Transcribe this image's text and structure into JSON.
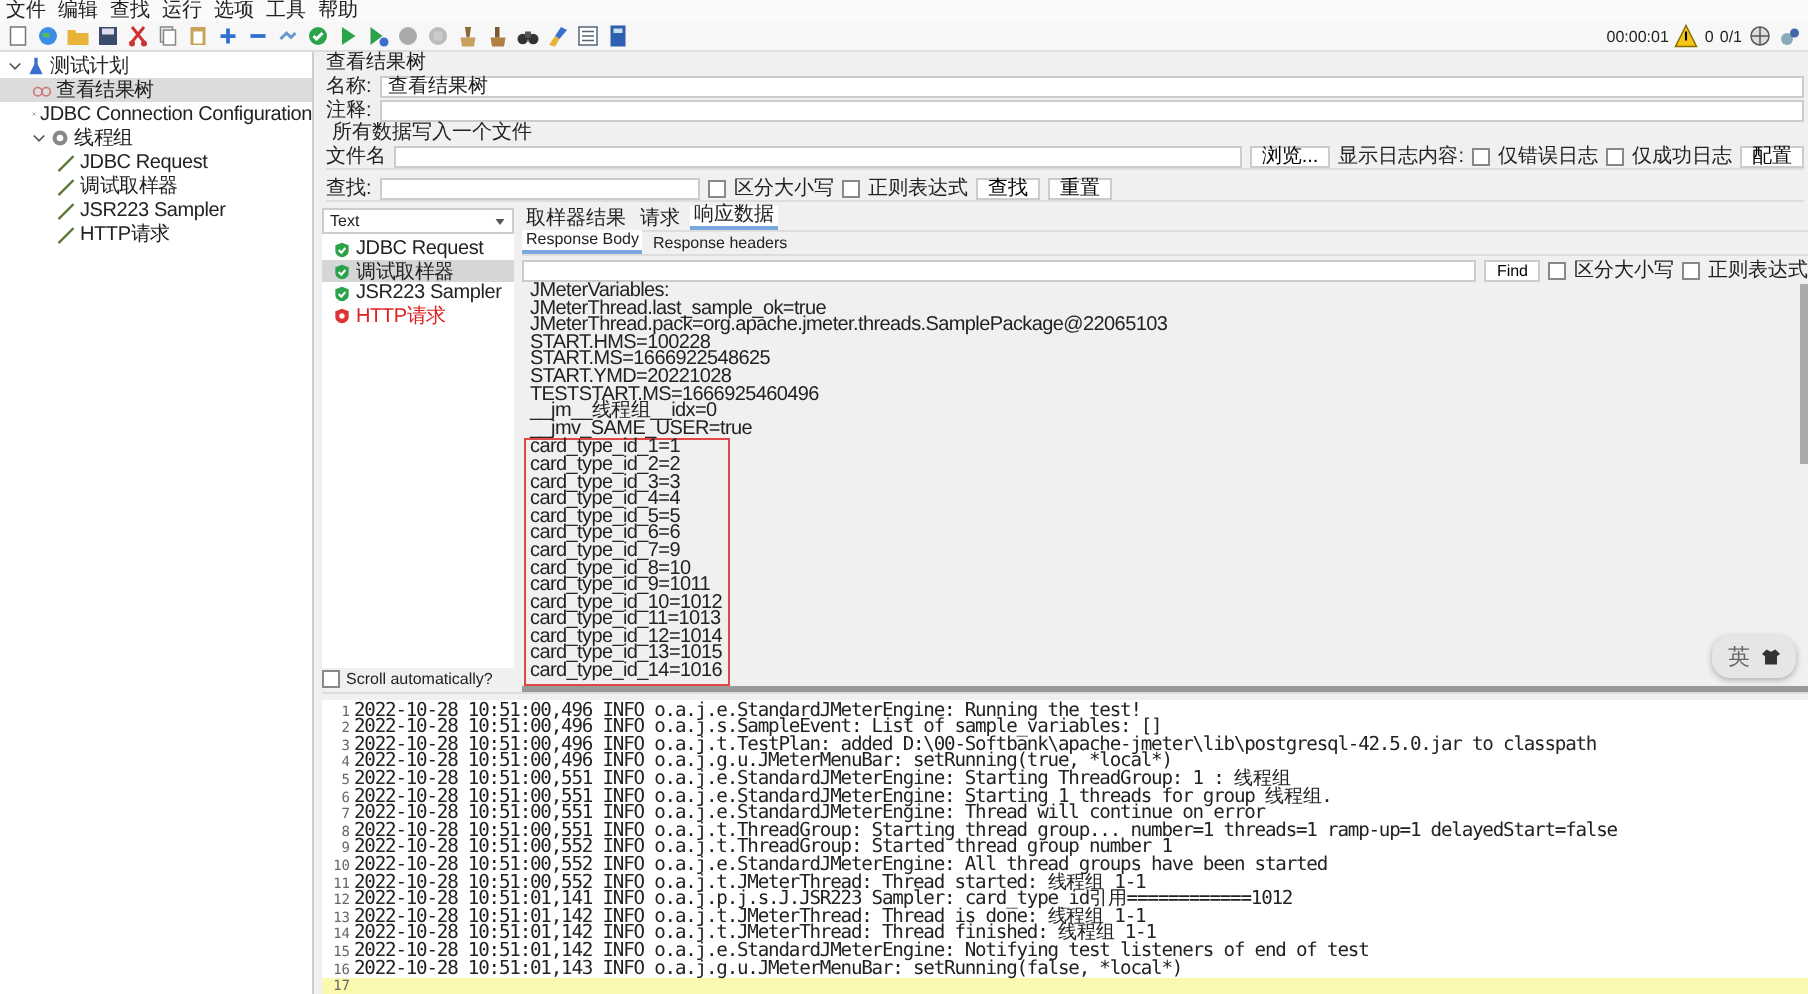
{
  "menu": [
    "文件",
    "编辑",
    "查找",
    "运行",
    "选项",
    "工具",
    "帮助"
  ],
  "toolbar": {
    "elapsed": "00:00:01",
    "warnings": "0",
    "threads": "0/1"
  },
  "tree": [
    {
      "label": "测试计划",
      "kind": "plan",
      "expanded": true,
      "selected": false,
      "children": [
        {
          "label": "查看结果树",
          "kind": "listener",
          "selected": true
        },
        {
          "label": "JDBC Connection Configuration",
          "kind": "config",
          "selected": false
        },
        {
          "label": "线程组",
          "kind": "group",
          "expanded": true,
          "selected": false,
          "children": [
            {
              "label": "JDBC Request",
              "kind": "sampler",
              "selected": false
            },
            {
              "label": "调试取样器",
              "kind": "sampler",
              "selected": false
            },
            {
              "label": "JSR223 Sampler",
              "kind": "sampler",
              "selected": false
            },
            {
              "label": "HTTP请求",
              "kind": "sampler",
              "selected": false
            }
          ]
        }
      ]
    }
  ],
  "panel": {
    "title": "查看结果树",
    "name_label": "名称:",
    "name_value": "查看结果树",
    "comment_label": "注释:",
    "file_section": "所有数据写入一个文件",
    "file_label": "文件名",
    "browse_button": "浏览...",
    "log_label": "显示日志内容:",
    "log_options": [
      {
        "label": "仅错误日志",
        "checked": false
      },
      {
        "label": "仅成功日志",
        "checked": false
      }
    ],
    "configure_button": "配置"
  },
  "search": {
    "label": "查找:",
    "options": [
      {
        "label": "区分大小写",
        "checked": false
      },
      {
        "label": "正则表达式",
        "checked": false
      }
    ],
    "buttons": [
      "查找",
      "重置"
    ]
  },
  "renderer": "Text",
  "samples": [
    {
      "name": "JDBC Request",
      "failed": false,
      "selected": false
    },
    {
      "name": "调试取样器",
      "failed": false,
      "selected": true
    },
    {
      "name": "JSR223 Sampler",
      "failed": false,
      "selected": false
    },
    {
      "name": "HTTP请求",
      "failed": true,
      "selected": false
    }
  ],
  "scroll_auto": {
    "label": "Scroll automatically?",
    "checked": false
  },
  "result_tabs": [
    {
      "label": "取样器结果",
      "selected": false
    },
    {
      "label": "请求",
      "selected": false
    },
    {
      "label": "响应数据",
      "selected": true
    }
  ],
  "body_tabs": [
    {
      "label": "Response Body",
      "selected": true
    },
    {
      "label": "Response headers",
      "selected": false
    }
  ],
  "find": {
    "button": "Find",
    "options": [
      {
        "label": "区分大小写",
        "checked": false
      },
      {
        "label": "正则表达式",
        "checked": false
      }
    ]
  },
  "response": {
    "lines": [
      "JMeterVariables:",
      "JMeterThread.last_sample_ok=true",
      "JMeterThread.pack=org.apache.jmeter.threads.SamplePackage@22065103",
      "START.HMS=100228",
      "START.MS=1666922548625",
      "START.YMD=20221028",
      "TESTSTART.MS=1666925460496",
      "__jm__线程组__idx=0",
      "__jmv_SAME_USER=true"
    ],
    "boxed_lines": [
      "card_type_id_1=1",
      "card_type_id_2=2",
      "card_type_id_3=3",
      "card_type_id_4=4",
      "card_type_id_5=5",
      "card_type_id_6=6",
      "card_type_id_7=9",
      "card_type_id_8=10",
      "card_type_id_9=1011",
      "card_type_id_10=1012",
      "card_type_id_11=1013",
      "card_type_id_12=1014",
      "card_type_id_13=1015",
      "card_type_id_14=1016"
    ]
  },
  "ime": {
    "label": "英"
  },
  "log": [
    {
      "no": "1",
      "text": "2022-10-28 10:51:00,496 INFO o.a.j.e.StandardJMeterEngine: Running the test!"
    },
    {
      "no": "2",
      "text": "2022-10-28 10:51:00,496 INFO o.a.j.s.SampleEvent: List of sample_variables: []"
    },
    {
      "no": "3",
      "text": "2022-10-28 10:51:00,496 INFO o.a.j.t.TestPlan: added D:\\00-Softbank\\apache-jmeter\\lib\\postgresql-42.5.0.jar to classpath"
    },
    {
      "no": "4",
      "text": "2022-10-28 10:51:00,496 INFO o.a.j.g.u.JMeterMenuBar: setRunning(true, *local*)"
    },
    {
      "no": "5",
      "text": "2022-10-28 10:51:00,551 INFO o.a.j.e.StandardJMeterEngine: Starting ThreadGroup: 1 : 线程组"
    },
    {
      "no": "6",
      "text": "2022-10-28 10:51:00,551 INFO o.a.j.e.StandardJMeterEngine: Starting 1 threads for group 线程组."
    },
    {
      "no": "7",
      "text": "2022-10-28 10:51:00,551 INFO o.a.j.e.StandardJMeterEngine: Thread will continue on error"
    },
    {
      "no": "8",
      "text": "2022-10-28 10:51:00,551 INFO o.a.j.t.ThreadGroup: Starting thread group... number=1 threads=1 ramp-up=1 delayedStart=false"
    },
    {
      "no": "9",
      "text": "2022-10-28 10:51:00,552 INFO o.a.j.t.ThreadGroup: Started thread group number 1"
    },
    {
      "no": "10",
      "text": "2022-10-28 10:51:00,552 INFO o.a.j.e.StandardJMeterEngine: All thread groups have been started"
    },
    {
      "no": "11",
      "text": "2022-10-28 10:51:00,552 INFO o.a.j.t.JMeterThread: Thread started: 线程组 1-1"
    },
    {
      "no": "12",
      "text": "2022-10-28 10:51:01,141 INFO o.a.j.p.j.s.J.JSR223 Sampler: card_type_id引用============1012"
    },
    {
      "no": "13",
      "text": "2022-10-28 10:51:01,142 INFO o.a.j.t.JMeterThread: Thread is done: 线程组 1-1"
    },
    {
      "no": "14",
      "text": "2022-10-28 10:51:01,142 INFO o.a.j.t.JMeterThread: Thread finished: 线程组 1-1"
    },
    {
      "no": "15",
      "text": "2022-10-28 10:51:01,142 INFO o.a.j.e.StandardJMeterEngine: Notifying test listeners of end of test"
    },
    {
      "no": "16",
      "text": "2022-10-28 10:51:01,143 INFO o.a.j.g.u.JMeterMenuBar: setRunning(false, *local*)"
    },
    {
      "no": "17",
      "current": true
    }
  ]
}
